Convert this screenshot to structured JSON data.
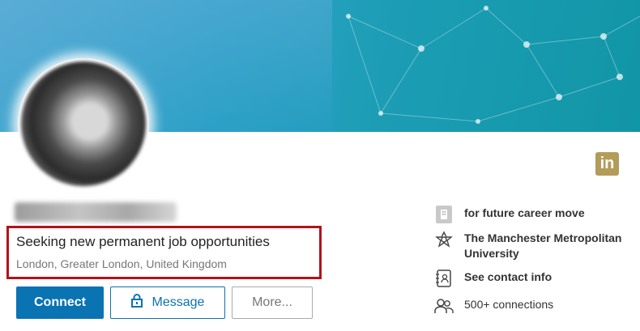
{
  "profile": {
    "headline": "Seeking new permanent job opportunities",
    "location": "London, Greater London, United Kingdom"
  },
  "actions": {
    "connect_label": "Connect",
    "message_label": "Message",
    "more_label": "More..."
  },
  "sidebar": {
    "items": [
      {
        "label": "for future career move",
        "icon": "company-building-icon"
      },
      {
        "label": "The Manchester Metropolitan University",
        "icon": "university-logo-icon"
      },
      {
        "label": "See contact info",
        "icon": "contact-card-icon"
      },
      {
        "label": "500+ connections",
        "icon": "people-icon"
      }
    ]
  },
  "branding": {
    "logo_text": "in"
  },
  "colors": {
    "accent": "#0a73b1",
    "highlight": "#b3121b",
    "logo": "#b39b59"
  }
}
